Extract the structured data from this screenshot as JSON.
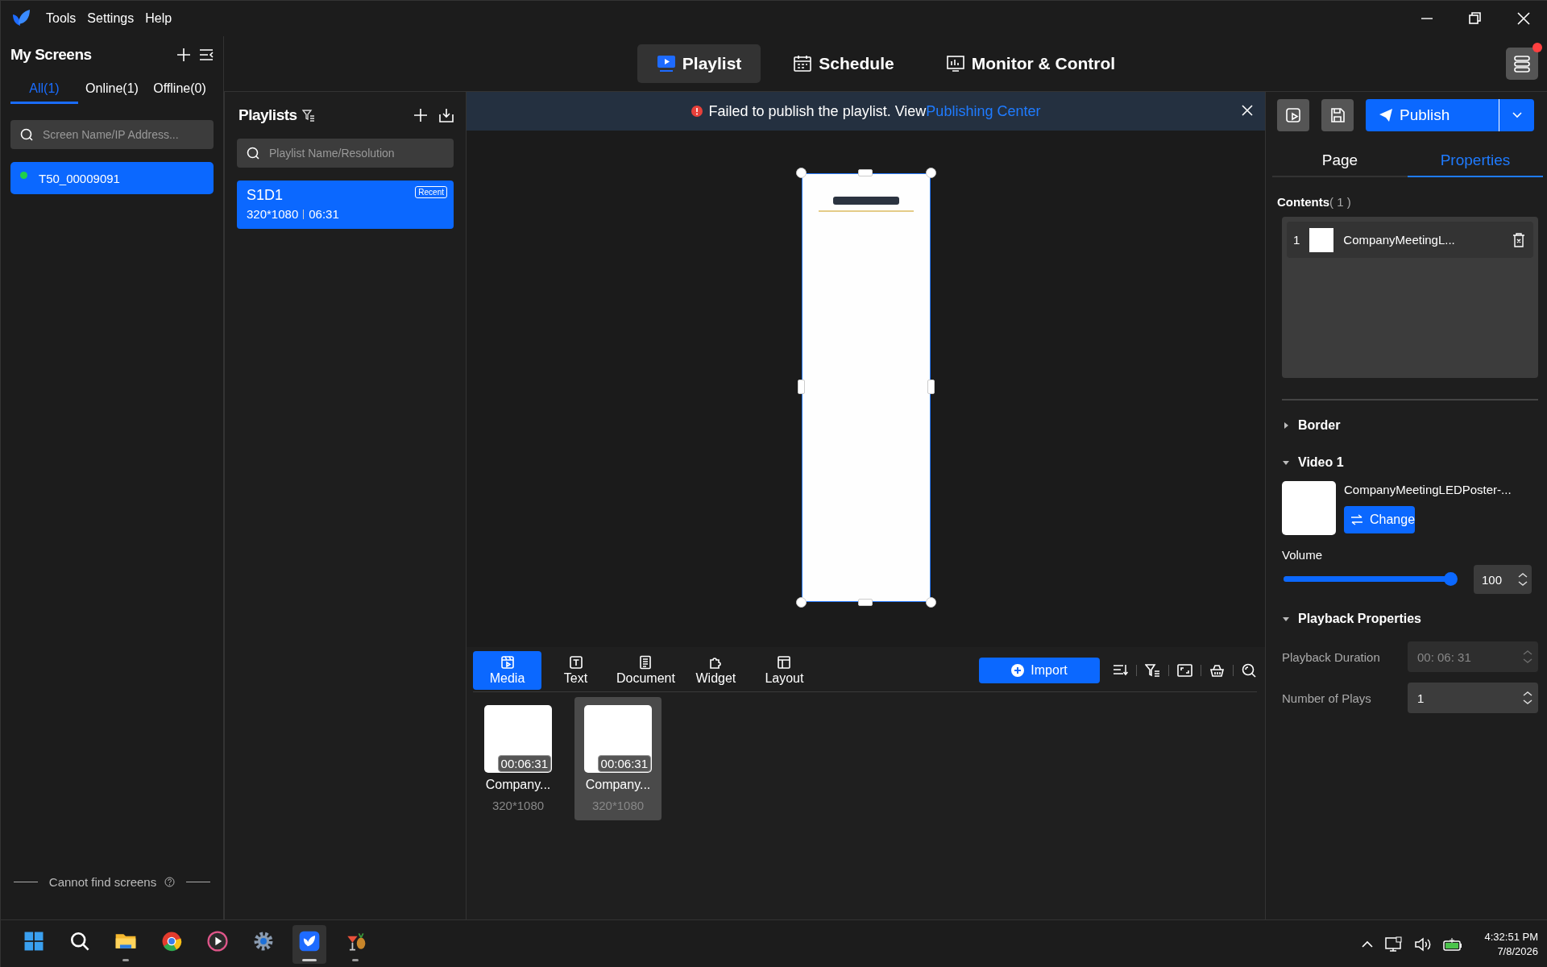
{
  "menu": [
    "Tools",
    "Settings",
    "Help"
  ],
  "nav_tabs": [
    {
      "label": "Playlist",
      "kind": "playlist",
      "selected": true
    },
    {
      "label": "Schedule",
      "kind": "schedule",
      "selected": false
    },
    {
      "label": "Monitor & Control",
      "kind": "monitor",
      "selected": false
    }
  ],
  "notification_dot": true,
  "screens": {
    "title": "My Screens",
    "tabs": [
      {
        "label": "All(1)",
        "selected": true
      },
      {
        "label": "Online(1)",
        "selected": false
      },
      {
        "label": "Offline(0)",
        "selected": false
      }
    ],
    "search": {
      "placeholder": "Screen Name/IP Address..."
    },
    "items": [
      {
        "name": "T50_00009091",
        "online": true,
        "selected": true
      }
    ],
    "footer": "Cannot find screens"
  },
  "playlists": {
    "title": "Playlists",
    "search": {
      "placeholder": "Playlist Name/Resolution"
    },
    "items": [
      {
        "name": "S1D1",
        "resolution": "320*1080",
        "duration": "06:31",
        "badge": "Recent",
        "selected": true
      }
    ]
  },
  "banner": {
    "message": "Failed to publish the playlist. View",
    "link": "Publishing Center"
  },
  "media": {
    "tabs": [
      {
        "label": "Media",
        "kind": "media",
        "selected": true
      },
      {
        "label": "Text",
        "kind": "text",
        "selected": false
      },
      {
        "label": "Document",
        "kind": "document",
        "selected": false
      },
      {
        "label": "Widget",
        "kind": "widget",
        "selected": false
      },
      {
        "label": "Layout",
        "kind": "layout",
        "selected": false
      }
    ],
    "import_button": "Import",
    "items": [
      {
        "name": "Company...",
        "duration": "00:06:31",
        "resolution": "320*1080",
        "selected": false
      },
      {
        "name": "Company...",
        "duration": "00:06:31",
        "resolution": "320*1080",
        "selected": true
      }
    ]
  },
  "properties": {
    "publish_button": "Publish",
    "tabs": [
      {
        "label": "Page",
        "selected": false
      },
      {
        "label": "Properties",
        "selected": true
      }
    ],
    "contents": {
      "title": "Contents",
      "count": "( 1 )",
      "items": [
        {
          "index": "1",
          "name": "CompanyMeetingL..."
        }
      ]
    },
    "sections": [
      {
        "kind": "border",
        "title": "Border",
        "expanded": false
      },
      {
        "kind": "video",
        "title": "Video 1",
        "expanded": true,
        "file": "CompanyMeetingLEDPoster-...",
        "change_button": "Change",
        "volume_label": "Volume",
        "level": 1,
        "volume_value": "100"
      },
      {
        "kind": "playback",
        "title": "Playback Properties",
        "expanded": true,
        "fields": [
          {
            "label": "Playback Duration",
            "value": "00: 06: 31",
            "disabled": true
          },
          {
            "label": "Number of Plays",
            "value": "1",
            "disabled": false
          }
        ]
      }
    ]
  },
  "taskbar": {
    "apps": [
      {
        "kind": "start",
        "running": false,
        "selected": false
      },
      {
        "kind": "search",
        "running": false,
        "selected": false
      },
      {
        "kind": "folder",
        "running": true,
        "selected": false
      },
      {
        "kind": "browser",
        "running": false,
        "selected": false
      },
      {
        "kind": "player",
        "running": false,
        "selected": false
      },
      {
        "kind": "settings",
        "running": false,
        "selected": false
      },
      {
        "kind": "app",
        "running": true,
        "selected": true
      },
      {
        "kind": "drink",
        "running": true,
        "selected": false
      }
    ],
    "time": "4:32:51 PM",
    "date": "7/8/2026"
  }
}
